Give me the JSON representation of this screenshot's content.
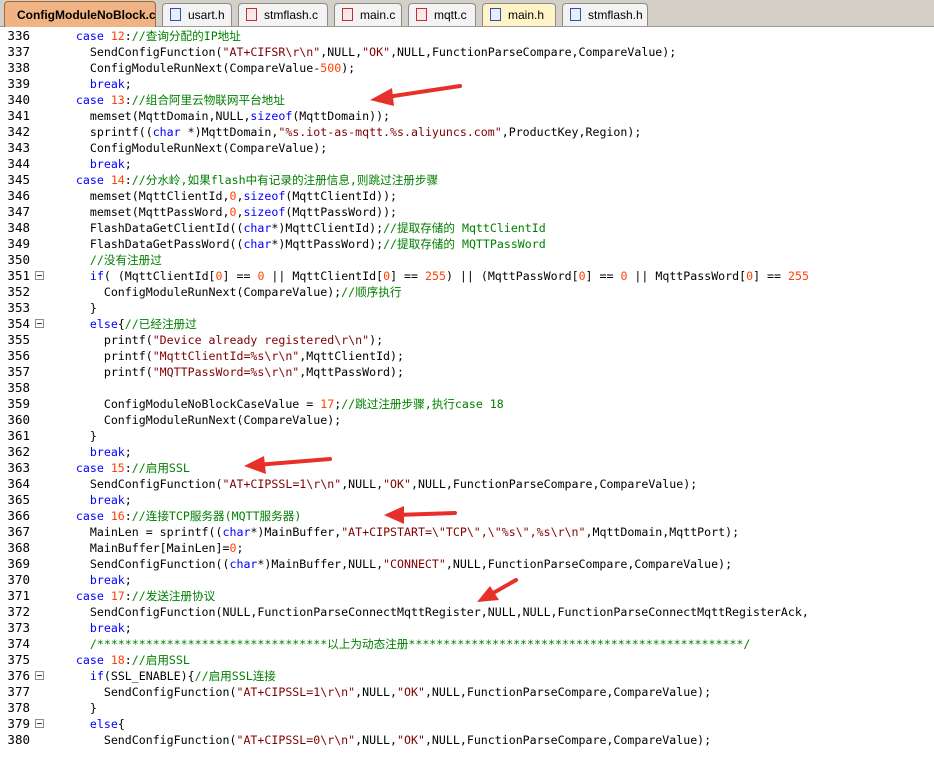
{
  "tabs": [
    {
      "label": "ConfigModuleNoBlock.c",
      "type": "c",
      "active": true
    },
    {
      "label": "usart.h",
      "type": "h",
      "active": false
    },
    {
      "label": "stmflash.c",
      "type": "c",
      "active": false
    },
    {
      "label": "main.c",
      "type": "c",
      "active": false
    },
    {
      "label": "mqtt.c",
      "type": "c",
      "active": false
    },
    {
      "label": "main.h",
      "type": "h",
      "active": false
    },
    {
      "label": "stmflash.h",
      "type": "h",
      "active": false
    }
  ],
  "colors": {
    "keyword": "#0000ff",
    "string": "#800000",
    "number": "#ff4000",
    "comment": "#008000",
    "annotation_arrow": "#e8302a",
    "active_tab": "#f0b484"
  },
  "lines": [
    {
      "n": "336",
      "fold": false,
      "tokens": [
        [
          "pl",
          "    "
        ],
        [
          "kw",
          "case "
        ],
        [
          "num",
          "12"
        ],
        [
          "pl",
          ":"
        ],
        [
          "cm",
          "//查询分配的IP地址"
        ]
      ]
    },
    {
      "n": "337",
      "fold": false,
      "tokens": [
        [
          "pl",
          "      SendConfigFunction("
        ],
        [
          "str",
          "\"AT+CIFSR\\r\\n\""
        ],
        [
          "pl",
          ",NULL,"
        ],
        [
          "str",
          "\"OK\""
        ],
        [
          "pl",
          ",NULL,FunctionParseCompare,CompareValue);"
        ]
      ]
    },
    {
      "n": "338",
      "fold": false,
      "tokens": [
        [
          "pl",
          "      ConfigModuleRunNext(CompareValue-"
        ],
        [
          "num",
          "500"
        ],
        [
          "pl",
          ");"
        ]
      ]
    },
    {
      "n": "339",
      "fold": false,
      "tokens": [
        [
          "pl",
          "      "
        ],
        [
          "kw",
          "break"
        ],
        [
          "pl",
          ";"
        ]
      ]
    },
    {
      "n": "340",
      "fold": false,
      "tokens": [
        [
          "pl",
          "    "
        ],
        [
          "kw",
          "case "
        ],
        [
          "num",
          "13"
        ],
        [
          "pl",
          ":"
        ],
        [
          "cm",
          "//组合阿里云物联网平台地址"
        ]
      ]
    },
    {
      "n": "341",
      "fold": false,
      "tokens": [
        [
          "pl",
          "      memset(MqttDomain,NULL,"
        ],
        [
          "kw",
          "sizeof"
        ],
        [
          "pl",
          "(MqttDomain));"
        ]
      ]
    },
    {
      "n": "342",
      "fold": false,
      "tokens": [
        [
          "pl",
          "      sprintf(("
        ],
        [
          "kw",
          "char"
        ],
        [
          "pl",
          " *)MqttDomain,"
        ],
        [
          "str",
          "\"%s.iot-as-mqtt.%s.aliyuncs.com\""
        ],
        [
          "pl",
          ",ProductKey,Region);"
        ]
      ]
    },
    {
      "n": "343",
      "fold": false,
      "tokens": [
        [
          "pl",
          "      ConfigModuleRunNext(CompareValue);"
        ]
      ]
    },
    {
      "n": "344",
      "fold": false,
      "tokens": [
        [
          "pl",
          "      "
        ],
        [
          "kw",
          "break"
        ],
        [
          "pl",
          ";"
        ]
      ]
    },
    {
      "n": "345",
      "fold": false,
      "tokens": [
        [
          "pl",
          "    "
        ],
        [
          "kw",
          "case "
        ],
        [
          "num",
          "14"
        ],
        [
          "pl",
          ":"
        ],
        [
          "cm",
          "//分水岭,如果flash中有记录的注册信息,则跳过注册步骤"
        ]
      ]
    },
    {
      "n": "346",
      "fold": false,
      "tokens": [
        [
          "pl",
          "      memset(MqttClientId,"
        ],
        [
          "num",
          "0"
        ],
        [
          "pl",
          ","
        ],
        [
          "kw",
          "sizeof"
        ],
        [
          "pl",
          "(MqttClientId));"
        ]
      ]
    },
    {
      "n": "347",
      "fold": false,
      "tokens": [
        [
          "pl",
          "      memset(MqttPassWord,"
        ],
        [
          "num",
          "0"
        ],
        [
          "pl",
          ","
        ],
        [
          "kw",
          "sizeof"
        ],
        [
          "pl",
          "(MqttPassWord));"
        ]
      ]
    },
    {
      "n": "348",
      "fold": false,
      "tokens": [
        [
          "pl",
          "      FlashDataGetClientId(("
        ],
        [
          "kw",
          "char"
        ],
        [
          "pl",
          "*)MqttClientId);"
        ],
        [
          "cm",
          "//提取存储的 MqttClientId"
        ]
      ]
    },
    {
      "n": "349",
      "fold": false,
      "tokens": [
        [
          "pl",
          "      FlashDataGetPassWord(("
        ],
        [
          "kw",
          "char"
        ],
        [
          "pl",
          "*)MqttPassWord);"
        ],
        [
          "cm",
          "//提取存储的 MQTTPassWord"
        ]
      ]
    },
    {
      "n": "350",
      "fold": false,
      "tokens": [
        [
          "pl",
          "      "
        ],
        [
          "cm",
          "//没有注册过"
        ]
      ]
    },
    {
      "n": "351",
      "fold": true,
      "tokens": [
        [
          "pl",
          "      "
        ],
        [
          "kw",
          "if"
        ],
        [
          "pl",
          "( (MqttClientId["
        ],
        [
          "num",
          "0"
        ],
        [
          "pl",
          "] == "
        ],
        [
          "num",
          "0"
        ],
        [
          "pl",
          " || MqttClientId["
        ],
        [
          "num",
          "0"
        ],
        [
          "pl",
          "] == "
        ],
        [
          "num",
          "255"
        ],
        [
          "pl",
          ") || (MqttPassWord["
        ],
        [
          "num",
          "0"
        ],
        [
          "pl",
          "] == "
        ],
        [
          "num",
          "0"
        ],
        [
          "pl",
          " || MqttPassWord["
        ],
        [
          "num",
          "0"
        ],
        [
          "pl",
          "] == "
        ],
        [
          "num",
          "255"
        ]
      ]
    },
    {
      "n": "352",
      "fold": false,
      "tokens": [
        [
          "pl",
          "        ConfigModuleRunNext(CompareValue);"
        ],
        [
          "cm",
          "//顺序执行"
        ]
      ]
    },
    {
      "n": "353",
      "fold": false,
      "tokens": [
        [
          "pl",
          "      }"
        ]
      ]
    },
    {
      "n": "354",
      "fold": true,
      "tokens": [
        [
          "pl",
          "      "
        ],
        [
          "kw",
          "else"
        ],
        [
          "pl",
          "{"
        ],
        [
          "cm",
          "//已经注册过"
        ]
      ]
    },
    {
      "n": "355",
      "fold": false,
      "tokens": [
        [
          "pl",
          "        printf("
        ],
        [
          "str",
          "\"Device already registered\\r\\n\""
        ],
        [
          "pl",
          ");"
        ]
      ]
    },
    {
      "n": "356",
      "fold": false,
      "tokens": [
        [
          "pl",
          "        printf("
        ],
        [
          "str",
          "\"MqttClientId=%s\\r\\n\""
        ],
        [
          "pl",
          ",MqttClientId);"
        ]
      ]
    },
    {
      "n": "357",
      "fold": false,
      "tokens": [
        [
          "pl",
          "        printf("
        ],
        [
          "str",
          "\"MQTTPassWord=%s\\r\\n\""
        ],
        [
          "pl",
          ",MqttPassWord);"
        ]
      ]
    },
    {
      "n": "358",
      "fold": false,
      "tokens": []
    },
    {
      "n": "359",
      "fold": false,
      "tokens": [
        [
          "pl",
          "        ConfigModuleNoBlockCaseValue = "
        ],
        [
          "num",
          "17"
        ],
        [
          "pl",
          ";"
        ],
        [
          "cm",
          "//跳过注册步骤,执行case 18"
        ]
      ]
    },
    {
      "n": "360",
      "fold": false,
      "tokens": [
        [
          "pl",
          "        ConfigModuleRunNext(CompareValue);"
        ]
      ]
    },
    {
      "n": "361",
      "fold": false,
      "tokens": [
        [
          "pl",
          "      }"
        ]
      ]
    },
    {
      "n": "362",
      "fold": false,
      "tokens": [
        [
          "pl",
          "      "
        ],
        [
          "kw",
          "break"
        ],
        [
          "pl",
          ";"
        ]
      ]
    },
    {
      "n": "363",
      "fold": false,
      "tokens": [
        [
          "pl",
          "    "
        ],
        [
          "kw",
          "case "
        ],
        [
          "num",
          "15"
        ],
        [
          "pl",
          ":"
        ],
        [
          "cm",
          "//启用SSL"
        ]
      ]
    },
    {
      "n": "364",
      "fold": false,
      "tokens": [
        [
          "pl",
          "      SendConfigFunction("
        ],
        [
          "str",
          "\"AT+CIPSSL=1\\r\\n\""
        ],
        [
          "pl",
          ",NULL,"
        ],
        [
          "str",
          "\"OK\""
        ],
        [
          "pl",
          ",NULL,FunctionParseCompare,CompareValue);"
        ]
      ]
    },
    {
      "n": "365",
      "fold": false,
      "tokens": [
        [
          "pl",
          "      "
        ],
        [
          "kw",
          "break"
        ],
        [
          "pl",
          ";"
        ]
      ]
    },
    {
      "n": "366",
      "fold": false,
      "tokens": [
        [
          "pl",
          "    "
        ],
        [
          "kw",
          "case "
        ],
        [
          "num",
          "16"
        ],
        [
          "pl",
          ":"
        ],
        [
          "cm",
          "//连接TCP服务器(MQTT服务器)"
        ]
      ]
    },
    {
      "n": "367",
      "fold": false,
      "tokens": [
        [
          "pl",
          "      MainLen = sprintf(("
        ],
        [
          "kw",
          "char"
        ],
        [
          "pl",
          "*)MainBuffer,"
        ],
        [
          "str",
          "\"AT+CIPSTART=\\\"TCP\\\",\\\"%s\\\",%s\\r\\n\""
        ],
        [
          "pl",
          ",MqttDomain,MqttPort);"
        ]
      ]
    },
    {
      "n": "368",
      "fold": false,
      "tokens": [
        [
          "pl",
          "      MainBuffer[MainLen]="
        ],
        [
          "num",
          "0"
        ],
        [
          "pl",
          ";"
        ]
      ]
    },
    {
      "n": "369",
      "fold": false,
      "tokens": [
        [
          "pl",
          "      SendConfigFunction(("
        ],
        [
          "kw",
          "char"
        ],
        [
          "pl",
          "*)MainBuffer,NULL,"
        ],
        [
          "str",
          "\"CONNECT\""
        ],
        [
          "pl",
          ",NULL,FunctionParseCompare,CompareValue);"
        ]
      ]
    },
    {
      "n": "370",
      "fold": false,
      "tokens": [
        [
          "pl",
          "      "
        ],
        [
          "kw",
          "break"
        ],
        [
          "pl",
          ";"
        ]
      ]
    },
    {
      "n": "371",
      "fold": false,
      "tokens": [
        [
          "pl",
          "    "
        ],
        [
          "kw",
          "case "
        ],
        [
          "num",
          "17"
        ],
        [
          "pl",
          ":"
        ],
        [
          "cm",
          "//发送注册协议"
        ]
      ]
    },
    {
      "n": "372",
      "fold": false,
      "tokens": [
        [
          "pl",
          "      SendConfigFunction(NULL,FunctionParseConnectMqttRegister,NULL,NULL,FunctionParseConnectMqttRegisterAck,"
        ]
      ]
    },
    {
      "n": "373",
      "fold": false,
      "tokens": [
        [
          "pl",
          "      "
        ],
        [
          "kw",
          "break"
        ],
        [
          "pl",
          ";"
        ]
      ]
    },
    {
      "n": "374",
      "fold": false,
      "tokens": [
        [
          "pl",
          "      "
        ],
        [
          "cm",
          "/*********************************以上为动态注册************************************************/"
        ]
      ]
    },
    {
      "n": "375",
      "fold": false,
      "tokens": [
        [
          "pl",
          "    "
        ],
        [
          "kw",
          "case "
        ],
        [
          "num",
          "18"
        ],
        [
          "pl",
          ":"
        ],
        [
          "cm",
          "//启用SSL"
        ]
      ]
    },
    {
      "n": "376",
      "fold": true,
      "tokens": [
        [
          "pl",
          "      "
        ],
        [
          "kw",
          "if"
        ],
        [
          "pl",
          "(SSL_ENABLE){"
        ],
        [
          "cm",
          "//启用SSL连接"
        ]
      ]
    },
    {
      "n": "377",
      "fold": false,
      "tokens": [
        [
          "pl",
          "        SendConfigFunction("
        ],
        [
          "str",
          "\"AT+CIPSSL=1\\r\\n\""
        ],
        [
          "pl",
          ",NULL,"
        ],
        [
          "str",
          "\"OK\""
        ],
        [
          "pl",
          ",NULL,FunctionParseCompare,CompareValue);"
        ]
      ]
    },
    {
      "n": "378",
      "fold": false,
      "tokens": [
        [
          "pl",
          "      }"
        ]
      ]
    },
    {
      "n": "379",
      "fold": true,
      "tokens": [
        [
          "pl",
          "      "
        ],
        [
          "kw",
          "else"
        ],
        [
          "pl",
          "{"
        ]
      ]
    },
    {
      "n": "380",
      "fold": false,
      "tokens": [
        [
          "pl",
          "        SendConfigFunction("
        ],
        [
          "str",
          "\"AT+CIPSSL=0\\r\\n\""
        ],
        [
          "pl",
          ",NULL,"
        ],
        [
          "str",
          "\"OK\""
        ],
        [
          "pl",
          ",NULL,FunctionParseCompare,CompareValue);"
        ]
      ]
    }
  ]
}
